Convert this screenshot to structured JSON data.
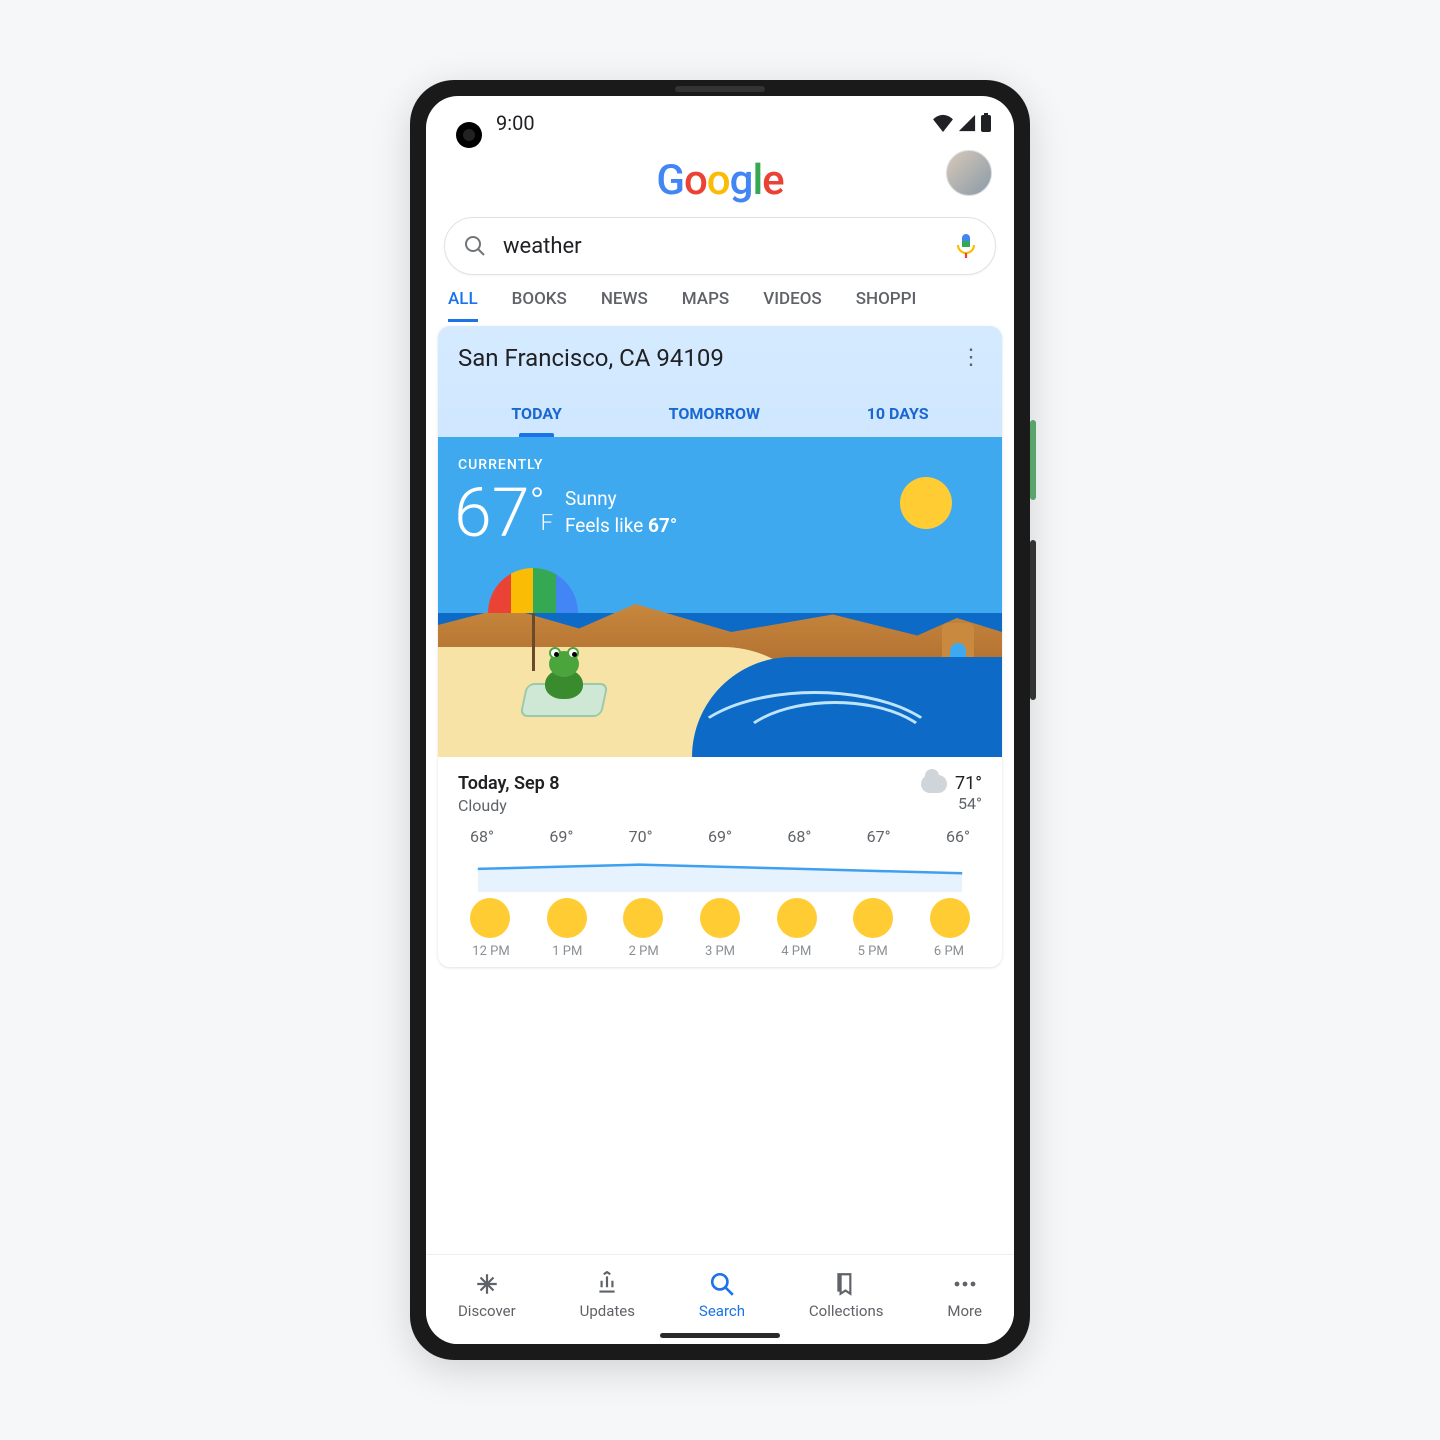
{
  "status": {
    "time": "9:00"
  },
  "logo_letters": [
    "G",
    "o",
    "o",
    "g",
    "l",
    "e"
  ],
  "search": {
    "query": "weather"
  },
  "tabs": [
    "ALL",
    "BOOKS",
    "NEWS",
    "MAPS",
    "VIDEOS",
    "SHOPPI"
  ],
  "active_tab": "ALL",
  "weather": {
    "location": "San Francisco, CA 94109",
    "tabs": [
      "TODAY",
      "TOMORROW",
      "10 DAYS"
    ],
    "active_tab": "TODAY",
    "currently_label": "CURRENTLY",
    "temp": "67",
    "unit": "F",
    "condition": "Sunny",
    "feels_prefix": "Feels like ",
    "feels_value": "67°",
    "today": {
      "title": "Today, Sep 8",
      "condition": "Cloudy",
      "hi": "71°",
      "lo": "54°"
    }
  },
  "chart_data": {
    "type": "line",
    "categories": [
      "12 PM",
      "1 PM",
      "2 PM",
      "3 PM",
      "4 PM",
      "5 PM",
      "6 PM"
    ],
    "values_label": [
      "68°",
      "69°",
      "70°",
      "69°",
      "68°",
      "67°",
      "66°"
    ],
    "values": [
      68,
      69,
      70,
      69,
      68,
      67,
      66
    ],
    "ylim": [
      60,
      75
    ]
  },
  "nav": {
    "items": [
      {
        "label": "Discover"
      },
      {
        "label": "Updates"
      },
      {
        "label": "Search"
      },
      {
        "label": "Collections"
      },
      {
        "label": "More"
      }
    ],
    "active": "Search"
  }
}
